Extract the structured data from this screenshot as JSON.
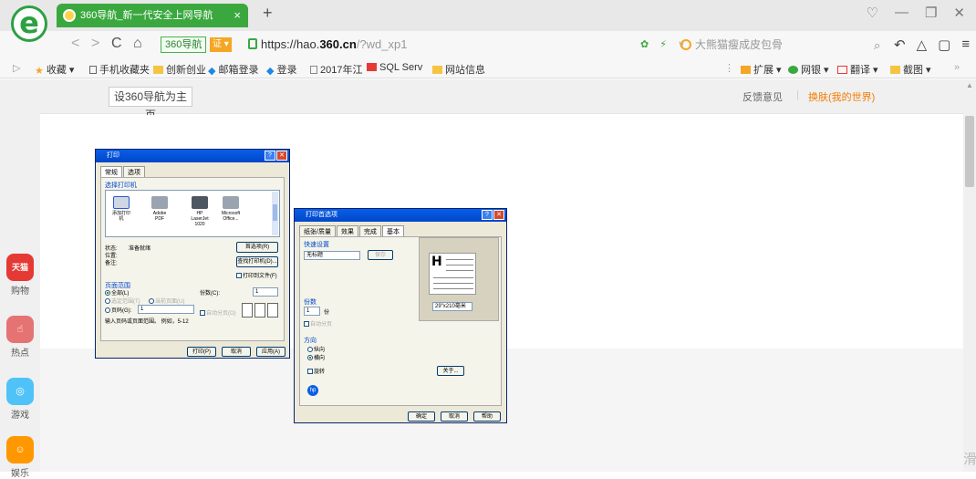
{
  "browser": {
    "tab_title": "360导航_新一代安全上网导航",
    "tab_close": "×",
    "new_tab": "+",
    "site_badge": "360导航",
    "cert_badge": "证 ▾",
    "url_prefix": "https://hao.",
    "url_domain": "360.cn",
    "url_path": "/?wd_xp1",
    "search_placeholder": "大熊猫瘦成皮包骨",
    "nav": {
      "back": "<",
      "forward": ">",
      "reload": "C",
      "home": "⌂"
    }
  },
  "bookmarks": [
    {
      "label": "收藏 ▾",
      "icon": "star-icon"
    },
    {
      "label": "手机收藏夹",
      "icon": "phone-icon"
    },
    {
      "label": "创新创业",
      "icon": "folder-icon"
    },
    {
      "label": "邮箱登录",
      "icon": "diamond-icon"
    },
    {
      "label": "登录",
      "icon": "diamond-icon"
    },
    {
      "label": "2017年江",
      "icon": "page-icon"
    },
    {
      "label": "SQL Serv",
      "icon": "sql-icon"
    },
    {
      "label": "网站信息",
      "icon": "folder-icon"
    }
  ],
  "bookmark_tools": [
    {
      "label": "扩展 ▾"
    },
    {
      "label": "网银 ▾"
    },
    {
      "label": "翻译 ▾"
    },
    {
      "label": "截图 ▾"
    }
  ],
  "page": {
    "set_homepage": "设360导航为主页",
    "feedback": "反馈意见",
    "separator": "|",
    "change_skin": "换肤(我的世界)"
  },
  "sidebar": [
    {
      "label": "购物",
      "icon_text": "天猫",
      "color": "#e53935"
    },
    {
      "label": "热点",
      "icon_text": "☝",
      "color": "#e57373"
    },
    {
      "label": "游戏",
      "icon_text": "◎",
      "color": "#4fc3f7"
    },
    {
      "label": "娱乐",
      "icon_text": "☺",
      "color": "#ff9800"
    }
  ],
  "print_dialog": {
    "title": "打印",
    "tabs": [
      "常规",
      "选项"
    ],
    "select_printer": "选择打印机",
    "printers": [
      "添加打印机",
      "Adobe PDF",
      "HP LaserJet 1020",
      "Microsoft Office..."
    ],
    "status_label": "状态:",
    "status_value": "准备就绪",
    "location_label": "位置:",
    "comment_label": "备注:",
    "preferences": "首选项(R)",
    "find_printer": "查找打印机(D)...",
    "print_to_file": "打印到文件(F)",
    "page_range": "页面范围",
    "all": "全部(L)",
    "selection": "选定范围(T)",
    "current_page": "当前页面(U)",
    "pages": "页码(G):",
    "pages_value": "1",
    "hint": "输入页码或页面范围。 例如，5-12",
    "copies_label": "份数(C):",
    "copies_value": "1",
    "collate": "自动分页(O)",
    "print_btn": "打印(P)",
    "cancel_btn": "取消",
    "apply_btn": "应用(A)"
  },
  "options_dialog": {
    "title": "打印首选项",
    "tabs": [
      "纸张/质量",
      "效果",
      "完成",
      "基本"
    ],
    "quick_set": "快速设置",
    "quick_value": "无标题",
    "save_btn": "保存",
    "copies_label": "份数",
    "copies_value": "1",
    "copies_unit": "份",
    "collate": "自动分页",
    "orientation": "方向",
    "portrait": "纵向",
    "landscape": "横向",
    "rotate": "旋转",
    "paper_size": "29\"x210毫米",
    "about_btn": "关于...",
    "ok_btn": "确定",
    "cancel_btn": "取消",
    "help_btn": "帮助"
  },
  "corner_glyph": "滑"
}
